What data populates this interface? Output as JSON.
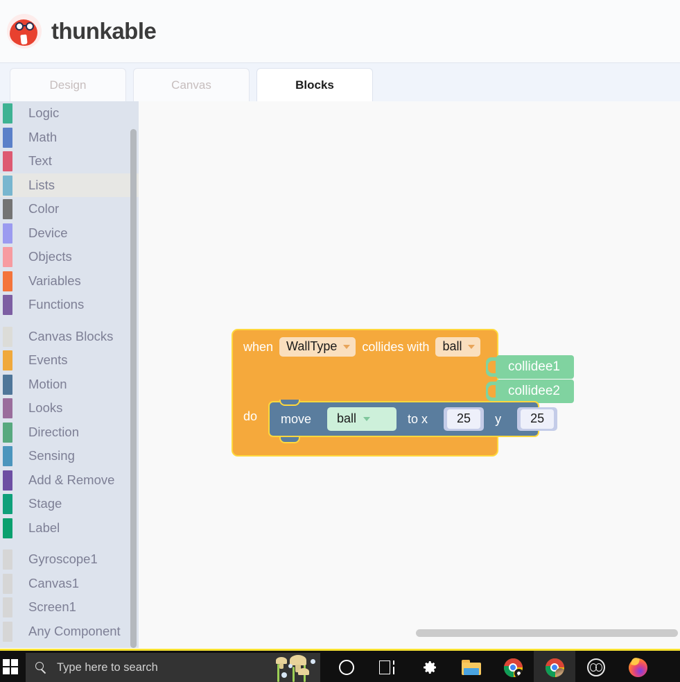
{
  "app": {
    "brand": "thunkable",
    "logo_icon": "thunkable-monster-logo-icon"
  },
  "tabs": [
    {
      "label": "Design",
      "active": false
    },
    {
      "label": "Canvas",
      "active": false
    },
    {
      "label": "Blocks",
      "active": true
    }
  ],
  "sidebar": {
    "categories": [
      {
        "label": "Logic",
        "color": "#3eb293",
        "selected": false
      },
      {
        "label": "Math",
        "color": "#5b80c9",
        "selected": false
      },
      {
        "label": "Text",
        "color": "#dd5a72",
        "selected": false
      },
      {
        "label": "Lists",
        "color": "#78b6cf",
        "selected": true
      },
      {
        "label": "Color",
        "color": "#747474",
        "selected": false
      },
      {
        "label": "Device",
        "color": "#9b9bf0",
        "selected": false
      },
      {
        "label": "Objects",
        "color": "#f79ba0",
        "selected": false
      },
      {
        "label": "Variables",
        "color": "#f4743b",
        "selected": false
      },
      {
        "label": "Functions",
        "color": "#7d5fa3",
        "selected": false
      }
    ],
    "canvas_categories": [
      {
        "label": "Canvas Blocks",
        "color": "#dcdcd8",
        "selected": false
      },
      {
        "label": "Events",
        "color": "#f0a93c",
        "selected": false
      },
      {
        "label": "Motion",
        "color": "#4f7699",
        "selected": false
      },
      {
        "label": "Looks",
        "color": "#9a6d9c",
        "selected": false
      },
      {
        "label": "Direction",
        "color": "#58a97f",
        "selected": false
      },
      {
        "label": "Sensing",
        "color": "#4b95bd",
        "selected": false
      },
      {
        "label": "Add & Remove",
        "color": "#6d4fa3",
        "selected": false
      },
      {
        "label": "Stage",
        "color": "#0fa07a",
        "selected": false
      },
      {
        "label": "Label",
        "color": "#0aa06e",
        "selected": false
      }
    ],
    "components": [
      {
        "label": "Gyroscope1",
        "color": "#d6d6d6",
        "selected": false
      },
      {
        "label": "Canvas1",
        "color": "#d6d6d6",
        "selected": false
      },
      {
        "label": "Screen1",
        "color": "#d6d6d6",
        "selected": false
      },
      {
        "label": "Any Component",
        "color": "#d6d6d6",
        "selected": false
      }
    ]
  },
  "workspace": {
    "event_block": {
      "keyword_when": "when",
      "sprite_type": "WallType",
      "keyword_collides": "collides with",
      "collider": "ball",
      "keyword_do": "do",
      "caret_icon": "chevron-down-icon"
    },
    "collidee_blocks": [
      {
        "label": "collidee1"
      },
      {
        "label": "collidee2"
      }
    ],
    "move_block": {
      "keyword_move": "move",
      "target": "ball",
      "keyword_to_x": "to x",
      "x_value": "25",
      "keyword_y": "y",
      "y_value": "25"
    },
    "colors": {
      "event_block": "#f5a93c",
      "event_border": "#ffd83d",
      "motion_block": "#5a7d9e",
      "value_green": "#80d3a0",
      "dropdown_field": "#fadfbe",
      "number_field": "#eef0fa"
    }
  },
  "taskbar": {
    "start_icon": "windows-start-icon",
    "search_icon": "search-icon",
    "search_placeholder": "Type here to search",
    "items": [
      {
        "name": "cortana-icon",
        "label": "Cortana",
        "state": "idle"
      },
      {
        "name": "task-view-icon",
        "label": "Task View",
        "state": "idle"
      },
      {
        "name": "settings-gear-icon",
        "label": "Settings",
        "state": "idle"
      },
      {
        "name": "file-explorer-icon",
        "label": "File Explorer",
        "state": "idle"
      },
      {
        "name": "chrome-icon",
        "label": "Google Chrome",
        "state": "running"
      },
      {
        "name": "chrome-profile-icon",
        "label": "Google Chrome",
        "state": "active"
      },
      {
        "name": "obs-studio-icon",
        "label": "OBS Studio",
        "state": "idle"
      },
      {
        "name": "firefox-icon",
        "label": "Mozilla Firefox",
        "state": "idle"
      }
    ]
  }
}
